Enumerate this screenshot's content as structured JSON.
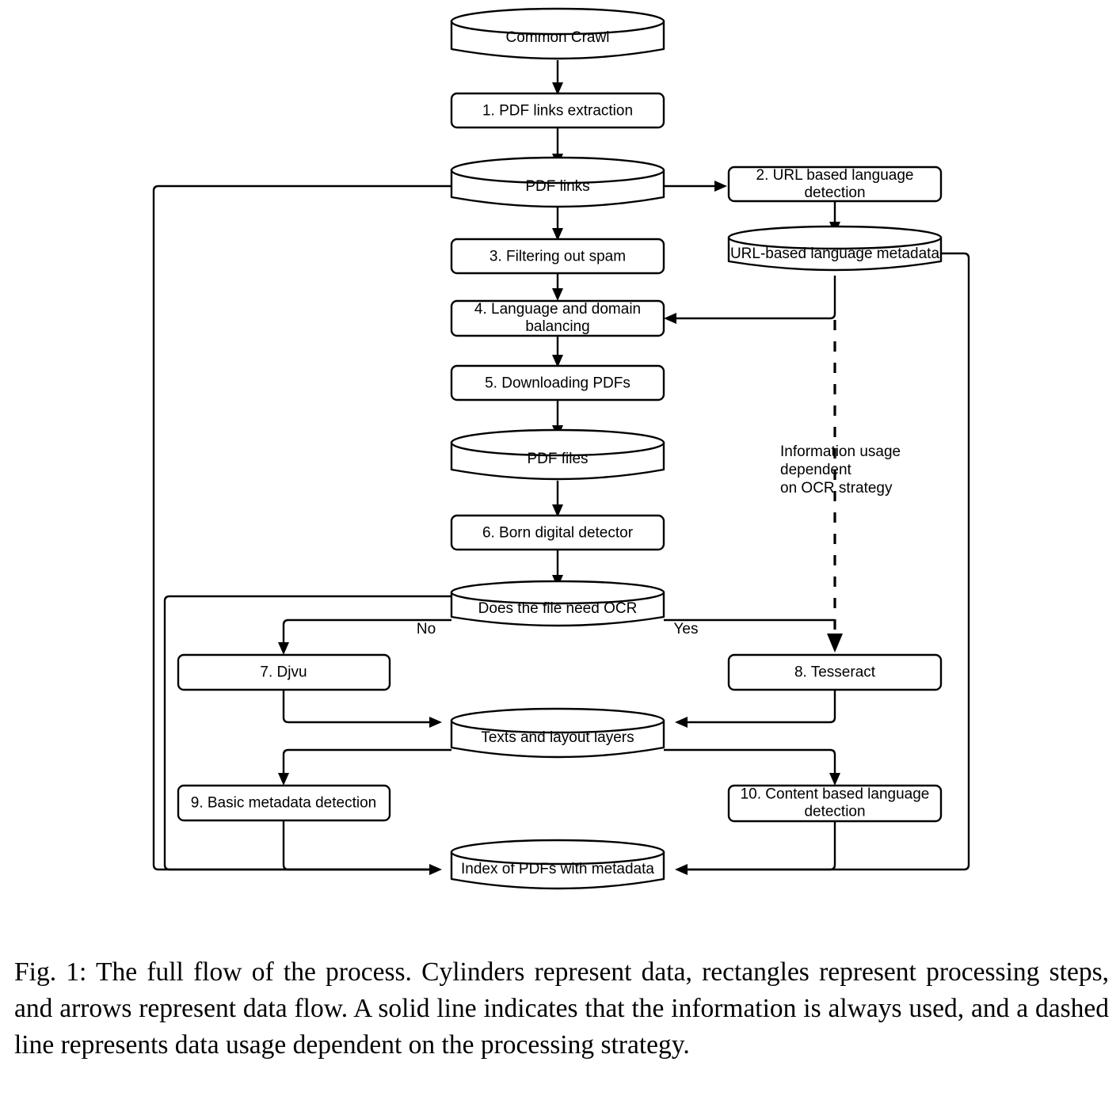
{
  "figure": {
    "caption": "Fig. 1: The full flow of the process. Cylinders represent data, rectangles represent processing steps, and arrows represent data flow. A solid line indicates that the information is always used, and a dashed line represents data usage dependent on the processing strategy."
  },
  "nodes": {
    "common_crawl": "Common Crawl",
    "step1": "1. PDF links extraction",
    "pdf_links": "PDF links",
    "step2_line1": "2. URL based language",
    "step2_line2": "detection",
    "url_metadata": "URL-based language metadata",
    "step3": "3. Filtering out spam",
    "step4_line1": "4. Language and domain",
    "step4_line2": "balancing",
    "step5": "5. Downloading PDFs",
    "pdf_files": "PDF files",
    "step6": "6. Born digital detector",
    "decision_ocr": "Does the file need OCR",
    "step7": "7. Djvu",
    "step8": "8. Tesseract",
    "texts_layers": "Texts and layout layers",
    "step9": "9. Basic metadata detection",
    "step10_line1": "10. Content based language",
    "step10_line2": "detection",
    "index_pdfs": "Index of PDFs with metadata"
  },
  "edge_labels": {
    "no": "No",
    "yes": "Yes"
  },
  "annotations": {
    "dashed_note_line1": "Information usage",
    "dashed_note_line2": "dependent",
    "dashed_note_line3": "on OCR strategy"
  },
  "colors": {
    "stroke": "#000000",
    "fill": "#ffffff",
    "text": "#000000"
  }
}
